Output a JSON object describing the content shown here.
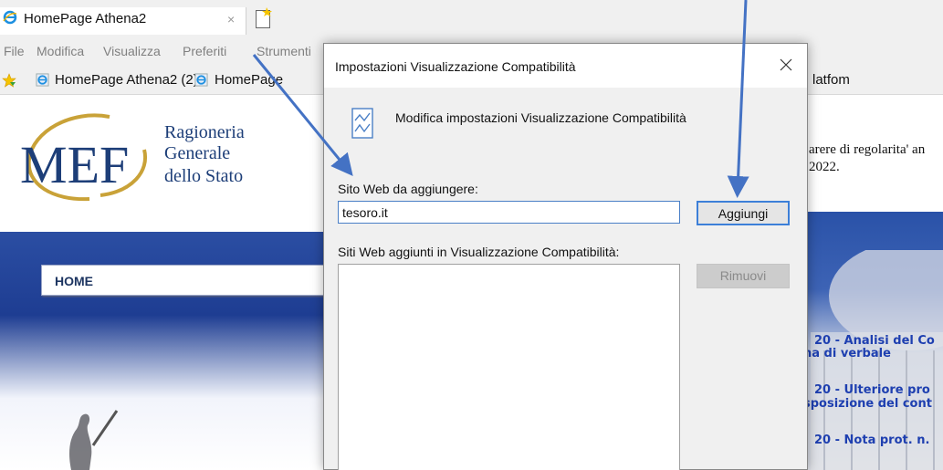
{
  "browser": {
    "tab": {
      "title": "HomePage Athena2",
      "close_glyph": "×"
    },
    "menu": [
      "File",
      "Modifica",
      "Visualizza",
      "Preferiti",
      "Strumenti"
    ],
    "favorites": [
      "HomePage Athena2 (2)",
      "HomePage"
    ],
    "favorites_right_fragment": "latfom"
  },
  "page": {
    "logo_text": "MEF",
    "org_lines": [
      "Ragioneria",
      "Generale",
      "dello Stato"
    ],
    "home_label": "HOME",
    "news_fragment_1": "arere di regolarita' an",
    "news_fragment_2": "2022.",
    "links": [
      "20 - Analisi del Co",
      "na di verbale",
      "20 - Ulteriore pro",
      "sposizione del cont",
      "20 - Nota prot. n."
    ]
  },
  "dialog": {
    "title": "Impostazioni Visualizzazione Compatibilità",
    "close_glyph": "×",
    "header_text": "Modifica impostazioni Visualizzazione Compatibilità",
    "add_label": "Sito Web da aggiungere:",
    "add_value": "tesoro.it",
    "add_button": "Aggiungi",
    "list_label": "Siti Web aggiunti in Visualizzazione Compatibilità:",
    "remove_button": "Rimuovi",
    "sites": []
  },
  "colors": {
    "arrow": "#4472c4",
    "accent": "#3c7fd8",
    "mef_blue": "#1d3e78",
    "mef_gold": "#c9a238"
  }
}
